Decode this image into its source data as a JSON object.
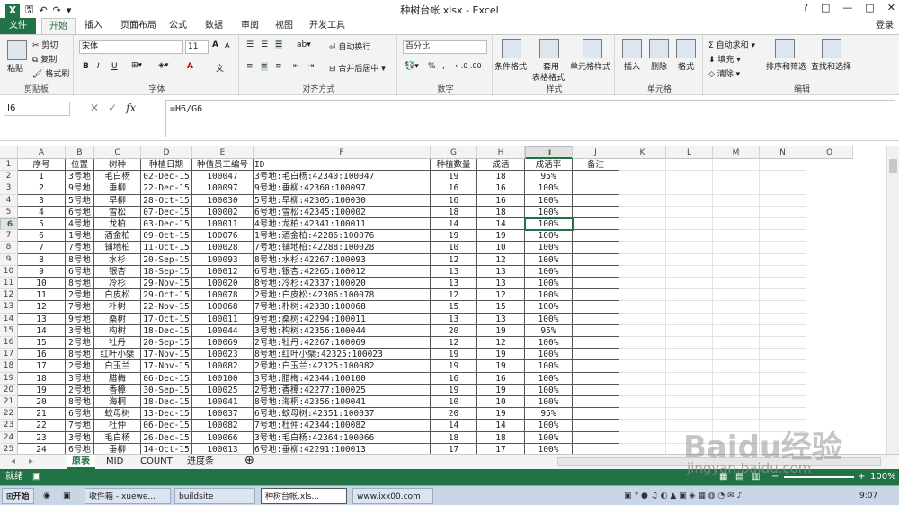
{
  "app": {
    "title": "种树台帐.xlsx - Excel",
    "login": "登录",
    "win_buttons": [
      "?",
      "□",
      "—",
      "□",
      "✕"
    ]
  },
  "tabs": [
    "文件",
    "开始",
    "插入",
    "页面布局",
    "公式",
    "数据",
    "审阅",
    "视图",
    "开发工具"
  ],
  "ribbon": {
    "clipboard": {
      "label": "剪贴板",
      "paste": "粘贴",
      "cut": "剪切",
      "copy": "复制",
      "format_painter": "格式刷"
    },
    "font": {
      "label": "字体",
      "name": "宋体",
      "size": "11",
      "bold": "B",
      "italic": "I",
      "underline": "U",
      "grow": "A",
      "shrink": "A",
      "fontcolor": "A",
      "wen": "文"
    },
    "align": {
      "label": "对齐方式",
      "wrap": "自动换行",
      "merge": "合并后居中"
    },
    "number": {
      "label": "数字",
      "format": "百分比",
      "percent": "%",
      "comma": ","
    },
    "styles": {
      "label": "样式",
      "conditional": "条件格式",
      "table_l1": "套用",
      "table_l2": "表格格式",
      "cell_styles": "单元格样式"
    },
    "cells": {
      "label": "单元格",
      "insert": "插入",
      "delete": "删除",
      "format": "格式"
    },
    "editing": {
      "label": "编辑",
      "autosum": "自动求和",
      "fill": "填充",
      "clear": "清除",
      "sort": "排序和筛选",
      "find": "查找和选择"
    }
  },
  "formula": {
    "namebox": "I6",
    "content": "=H6/G6",
    "fx": "fx",
    "cancel": "✕",
    "enter": "✓"
  },
  "columns": [
    "A",
    "B",
    "C",
    "D",
    "E",
    "F",
    "G",
    "H",
    "I",
    "J",
    "K",
    "L",
    "M",
    "N",
    "O"
  ],
  "headers": [
    "序号",
    "位置",
    "树种",
    "种植日期",
    "种值员工编号",
    "ID",
    "种植数量",
    "成活",
    "成活率",
    "备注"
  ],
  "rows": [
    [
      "1",
      "3号地",
      "毛白杨",
      "02-Dec-15",
      "100047",
      "3号地:毛白杨:42340:100047",
      "19",
      "18",
      "95%"
    ],
    [
      "2",
      "9号地",
      "垂柳",
      "22-Dec-15",
      "100097",
      "9号地:垂柳:42360:100097",
      "16",
      "16",
      "100%"
    ],
    [
      "3",
      "5号地",
      "旱柳",
      "28-Oct-15",
      "100030",
      "5号地:旱柳:42305:100030",
      "16",
      "16",
      "100%"
    ],
    [
      "4",
      "6号地",
      "雪松",
      "07-Dec-15",
      "100002",
      "6号地:雪松:42345:100002",
      "18",
      "18",
      "100%"
    ],
    [
      "5",
      "4号地",
      "龙柏",
      "03-Dec-15",
      "100011",
      "4号地:龙柏:42341:100011",
      "14",
      "14",
      "100%"
    ],
    [
      "6",
      "1号地",
      "酒金柏",
      "09-Oct-15",
      "100076",
      "1号地:酒金柏:42286:100076",
      "19",
      "19",
      "100%"
    ],
    [
      "7",
      "7号地",
      "铺地柏",
      "11-Oct-15",
      "100028",
      "7号地:铺地柏:42288:100028",
      "10",
      "10",
      "100%"
    ],
    [
      "8",
      "8号地",
      "水杉",
      "20-Sep-15",
      "100093",
      "8号地:水杉:42267:100093",
      "12",
      "12",
      "100%"
    ],
    [
      "9",
      "6号地",
      "银杏",
      "18-Sep-15",
      "100012",
      "6号地:银杏:42265:100012",
      "13",
      "13",
      "100%"
    ],
    [
      "10",
      "8号地",
      "冷杉",
      "29-Nov-15",
      "100020",
      "8号地:冷杉:42337:100020",
      "13",
      "13",
      "100%"
    ],
    [
      "11",
      "2号地",
      "白皮松",
      "29-Oct-15",
      "100078",
      "2号地:白皮松:42306:100078",
      "12",
      "12",
      "100%"
    ],
    [
      "12",
      "7号地",
      "朴树",
      "22-Nov-15",
      "100068",
      "7号地:朴树:42330:100068",
      "15",
      "15",
      "100%"
    ],
    [
      "13",
      "9号地",
      "桑树",
      "17-Oct-15",
      "100011",
      "9号地:桑树:42294:100011",
      "13",
      "13",
      "100%"
    ],
    [
      "14",
      "3号地",
      "构树",
      "18-Dec-15",
      "100044",
      "3号地:构树:42356:100044",
      "20",
      "19",
      "95%"
    ],
    [
      "15",
      "2号地",
      "牡丹",
      "20-Sep-15",
      "100069",
      "2号地:牡丹:42267:100069",
      "12",
      "12",
      "100%"
    ],
    [
      "16",
      "8号地",
      "红叶小檗",
      "17-Nov-15",
      "100023",
      "8号地:红叶小檗:42325:100023",
      "19",
      "19",
      "100%"
    ],
    [
      "17",
      "2号地",
      "白玉兰",
      "17-Nov-15",
      "100082",
      "2号地:白玉兰:42325:100082",
      "19",
      "19",
      "100%"
    ],
    [
      "18",
      "3号地",
      "腊梅",
      "06-Dec-15",
      "100100",
      "3号地:腊梅:42344:100100",
      "16",
      "16",
      "100%"
    ],
    [
      "19",
      "2号地",
      "香樟",
      "30-Sep-15",
      "100025",
      "2号地:香樟:42277:100025",
      "19",
      "19",
      "100%"
    ],
    [
      "20",
      "8号地",
      "海桐",
      "18-Dec-15",
      "100041",
      "8号地:海桐:42356:100041",
      "10",
      "10",
      "100%"
    ],
    [
      "21",
      "6号地",
      "蚊母树",
      "13-Dec-15",
      "100037",
      "6号地:蚊母树:42351:100037",
      "20",
      "19",
      "95%"
    ],
    [
      "22",
      "7号地",
      "杜仲",
      "06-Dec-15",
      "100082",
      "7号地:杜仲:42344:100082",
      "14",
      "14",
      "100%"
    ],
    [
      "23",
      "3号地",
      "毛白杨",
      "26-Dec-15",
      "100066",
      "3号地:毛白杨:42364:100066",
      "18",
      "18",
      "100%"
    ],
    [
      "24",
      "6号地",
      "垂柳",
      "14-Oct-15",
      "100013",
      "6号地:垂柳:42291:100013",
      "17",
      "17",
      "100%"
    ]
  ],
  "sheets": [
    "原表",
    "MID",
    "COUNT",
    "进度条"
  ],
  "status": {
    "left": "就绪",
    "zoom": "100%"
  },
  "taskbar": {
    "start": "开始",
    "items": [
      "收件箱 - xuewe...",
      "buildsite",
      "种树台帐.xls...",
      "www.ixx00.com"
    ],
    "time": "9:07"
  },
  "watermark": {
    "logo": "Baidu经验",
    "url": "jingyan.baidu.com"
  }
}
